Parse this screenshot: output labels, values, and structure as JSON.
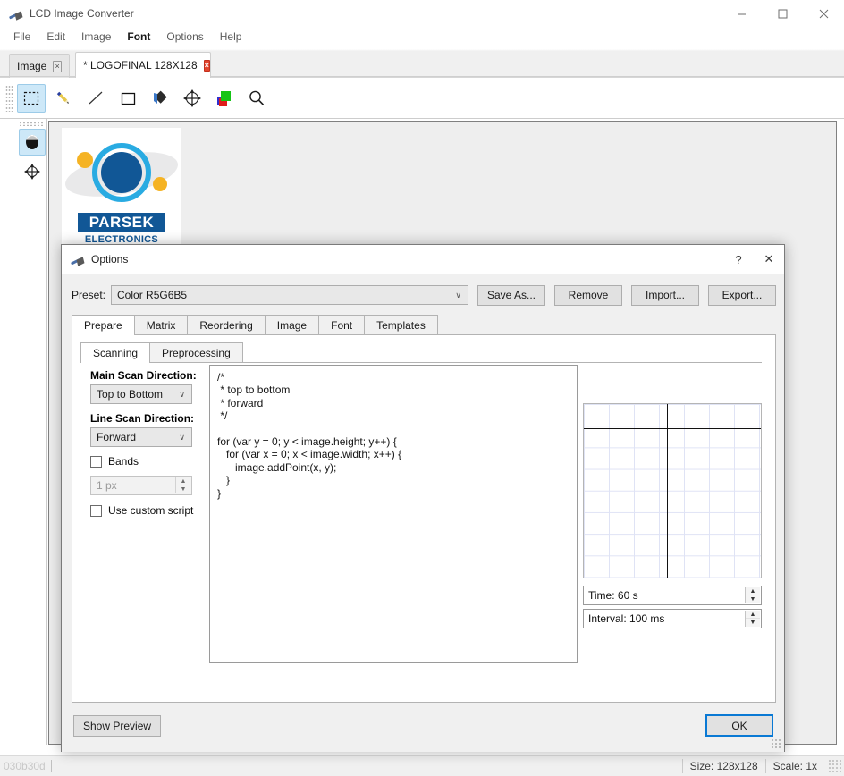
{
  "window": {
    "title": "LCD Image Converter",
    "icon": "brush-icon",
    "controls": {
      "minimize": "minimize-icon",
      "maximize": "maximize-icon",
      "close": "close-icon"
    }
  },
  "menu": {
    "items": [
      {
        "label": "File",
        "bold": false
      },
      {
        "label": "Edit",
        "bold": false
      },
      {
        "label": "Image",
        "bold": false
      },
      {
        "label": "Font",
        "bold": true
      },
      {
        "label": "Options",
        "bold": false
      },
      {
        "label": "Help",
        "bold": false
      }
    ]
  },
  "tabs": [
    {
      "label": "Image",
      "active": false,
      "close": "×"
    },
    {
      "label": "* LOGOFINAL 128X128",
      "active": true,
      "close": "×"
    }
  ],
  "toolbar": {
    "items": [
      {
        "name": "select-rectangle-tool",
        "selected": true
      },
      {
        "name": "pencil-tool",
        "selected": false
      },
      {
        "name": "line-tool",
        "selected": false
      },
      {
        "name": "rectangle-tool",
        "selected": false
      },
      {
        "name": "fill-tool",
        "selected": false
      },
      {
        "name": "move-tool",
        "selected": false
      },
      {
        "name": "color-layers-tool",
        "selected": false
      },
      {
        "name": "zoom-tool",
        "selected": false
      }
    ]
  },
  "left_tools": [
    {
      "name": "color-pick-tool",
      "selected": true
    },
    {
      "name": "pan-tool",
      "selected": false
    }
  ],
  "canvas": {
    "logo": {
      "brand": "PARSEK",
      "subtitle": "ELECTRONICS",
      "colors": {
        "core": "#115796",
        "ring": "#29abe2",
        "dot": "#f5b324",
        "orbit": "#e9e9ea"
      }
    }
  },
  "statusbar": {
    "left_text": "030b30d",
    "size": "Size: 128x128",
    "scale": "Scale: 1x"
  },
  "dialog": {
    "title": "Options",
    "icon": "brush-icon",
    "help_label": "?",
    "close_label": "✕",
    "preset": {
      "label": "Preset:",
      "value": "Color R5G6B5",
      "chevron": "∨"
    },
    "preset_buttons": [
      {
        "label": "Save As..."
      },
      {
        "label": "Remove"
      },
      {
        "label": "Import..."
      },
      {
        "label": "Export..."
      }
    ],
    "main_tabs": [
      {
        "label": "Prepare",
        "active": true
      },
      {
        "label": "Matrix",
        "active": false
      },
      {
        "label": "Reordering",
        "active": false
      },
      {
        "label": "Image",
        "active": false
      },
      {
        "label": "Font",
        "active": false
      },
      {
        "label": "Templates",
        "active": false
      }
    ],
    "sub_tabs": [
      {
        "label": "Scanning",
        "active": true
      },
      {
        "label": "Preprocessing",
        "active": false
      }
    ],
    "scanning": {
      "main_scan_direction_label": "Main Scan Direction:",
      "main_scan_direction_value": "Top to Bottom",
      "line_scan_direction_label": "Line Scan Direction:",
      "line_scan_direction_value": "Forward",
      "bands_label": "Bands",
      "bands_checked": false,
      "band_width_value": "1 px",
      "band_width_enabled": false,
      "use_custom_script_label": "Use custom script",
      "use_custom_script_checked": false,
      "chevron": "∨",
      "spin_up": "▲",
      "spin_down": "▼"
    },
    "script": "/*\n * top to bottom\n * forward\n */\n\nfor (var y = 0; y < image.height; y++) {\n   for (var x = 0; x < image.width; x++) {\n      image.addPoint(x, y);\n   }\n}",
    "preview": {
      "grid_cols": 7,
      "grid_rows": 8,
      "grid_color": "#dfe3f5",
      "axis_color": "#111111",
      "time_value": "Time: 60 s",
      "interval_value": "Interval: 100 ms",
      "spin_up": "▲",
      "spin_down": "▼"
    },
    "footer": {
      "show_preview_label": "Show Preview",
      "ok_label": "OK"
    }
  }
}
